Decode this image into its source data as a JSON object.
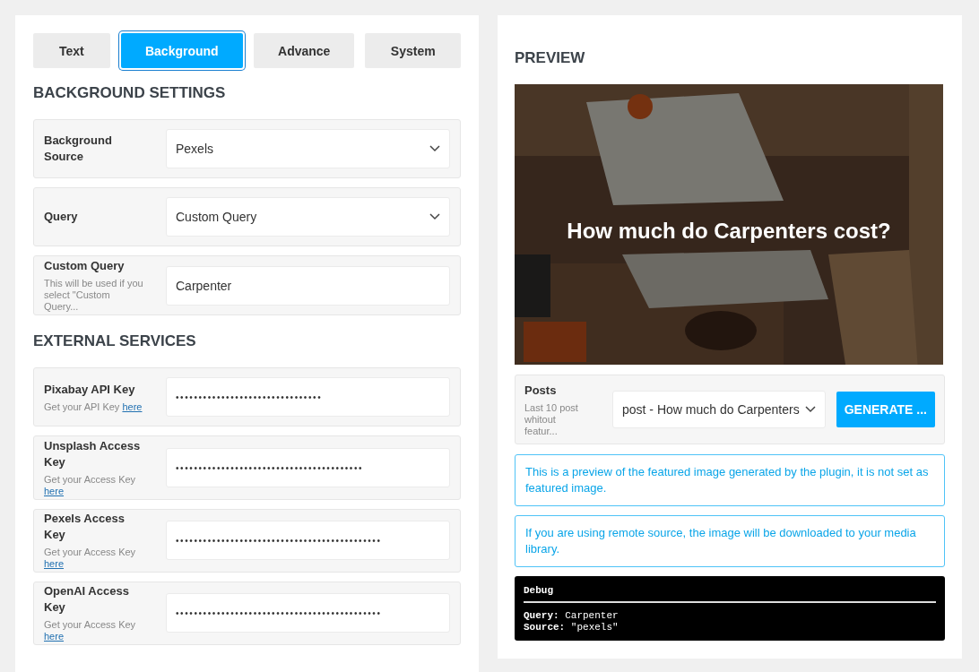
{
  "tabs": [
    {
      "label": "Text",
      "selected": false
    },
    {
      "label": "Background",
      "selected": true
    },
    {
      "label": "Advance",
      "selected": false
    },
    {
      "label": "System",
      "selected": false
    }
  ],
  "sections": [
    {
      "heading": "BACKGROUND SETTINGS",
      "fields": [
        {
          "kind": "select",
          "label": "Background Source",
          "value": "Pexels"
        },
        {
          "kind": "select",
          "label": "Query",
          "value": "Custom Query"
        },
        {
          "kind": "text",
          "label": "Custom Query",
          "hint": "This will be used if you select \"Custom Query...",
          "value": "Carpenter"
        }
      ]
    },
    {
      "heading": "EXTERNAL SERVICES",
      "fields": [
        {
          "kind": "secret",
          "label": "Pixabay API Key",
          "hint": "Get your API Key",
          "link": "here",
          "value": "••••••••••••••••••••••••••••••••"
        },
        {
          "kind": "secret",
          "label": "Unsplash Access Key",
          "hint": "Get your Access Key",
          "link": "here",
          "value": "•••••••••••••••••••••••••••••••••••••••••"
        },
        {
          "kind": "secret",
          "label": "Pexels Access Key",
          "hint": "Get your Access Key",
          "link": "here",
          "value": "•••••••••••••••••••••••••••••••••••••••••••••"
        },
        {
          "kind": "secret",
          "label": "OpenAI Access Key",
          "hint": "Get your Access Key",
          "link": "here",
          "value": "•••••••••••••••••••••••••••••••••••••••••••••"
        }
      ]
    }
  ],
  "preview": {
    "heading": "PREVIEW",
    "image": {
      "caption": "How much do Carpenters cost?"
    },
    "posts": {
      "label": "Posts",
      "hint": "Last 10 post whitout featur...",
      "value": "post - How much do Carpenters",
      "button": "GENERATE ..."
    },
    "notes": [
      "This is a preview of the featured image generated by the plugin, it is not set as featured image.",
      "If you are using remote source, the image will be downloaded to your media library."
    ],
    "debug": {
      "title": "Debug",
      "lines": [
        {
          "key": "Query:",
          "value": "Carpenter"
        },
        {
          "key": "Source:",
          "value": "\"pexels\""
        }
      ]
    }
  }
}
